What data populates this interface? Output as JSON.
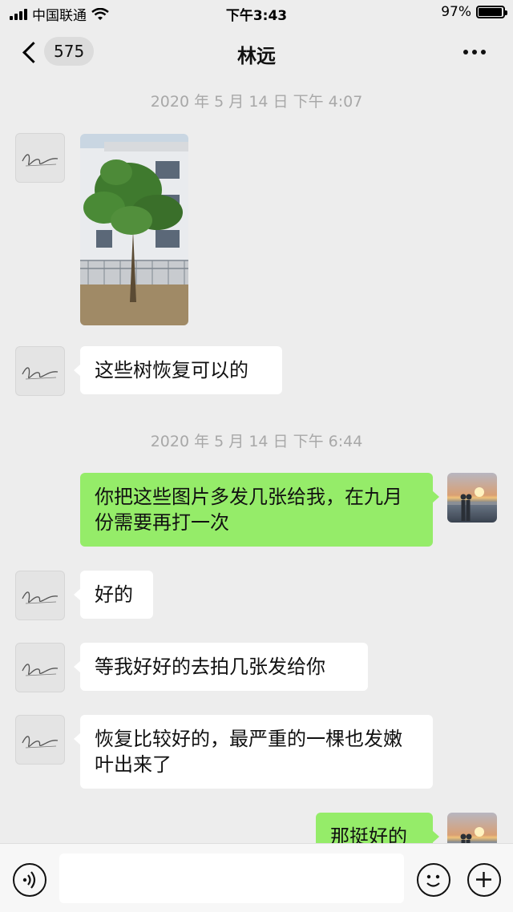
{
  "status_bar": {
    "carrier": "中国联通",
    "time": "下午3:43",
    "battery": "97%",
    "battery_level": 0.97
  },
  "nav": {
    "unread_count": "575",
    "title": "林远",
    "icons": [
      "chevron-left-icon",
      "more-icon"
    ]
  },
  "messages": [
    {
      "type": "timestamp",
      "text": "2020 年 5 月 14 日  下午 4:07"
    },
    {
      "type": "image",
      "from": "other",
      "content": "photo of a tree in front of a building"
    },
    {
      "type": "text",
      "from": "other",
      "text": "这些树恢复可以的"
    },
    {
      "type": "timestamp",
      "text": "2020 年 5 月 14 日  下午 6:44"
    },
    {
      "type": "text",
      "from": "self",
      "text": "你把这些图片多发几张给我，在九月份需要再打一次"
    },
    {
      "type": "text",
      "from": "other",
      "text": "好的"
    },
    {
      "type": "text",
      "from": "other",
      "text": "等我好好的去拍几张发给你"
    },
    {
      "type": "text",
      "from": "other",
      "text": "恢复比较好的，最严重的一棵也发嫩叶出来了"
    },
    {
      "type": "text",
      "from": "self",
      "text": "那挺好的"
    }
  ],
  "input_bar": {
    "placeholder": "",
    "icons": [
      "voice-icon",
      "emoji-icon",
      "plus-icon"
    ]
  },
  "colors": {
    "background": "#ededed",
    "bubble_out": "#95ec69",
    "bubble_in": "#ffffff",
    "timestamp": "#a8a8a8"
  }
}
